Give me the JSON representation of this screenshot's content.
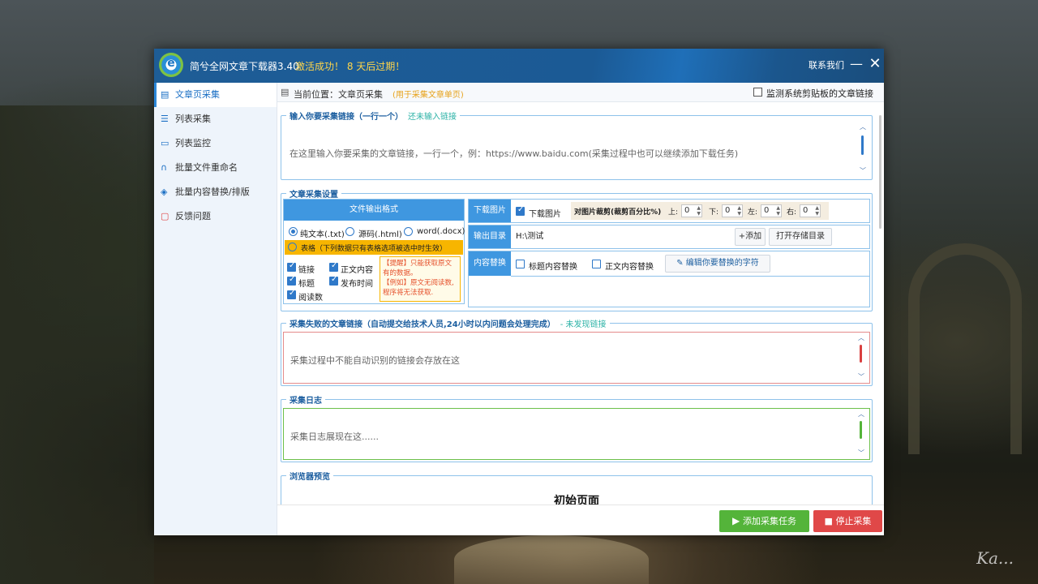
{
  "window": {
    "title": "简兮全网文章下载器3.40",
    "activation": "激活成功！ 8 天后过期！",
    "contact": "联系我们",
    "minimize": "—",
    "close": "✕"
  },
  "sidebar": {
    "items": [
      {
        "label": "文章页采集",
        "icon": "document-icon",
        "active": true
      },
      {
        "label": "列表采集",
        "icon": "list-search-icon",
        "active": false
      },
      {
        "label": "列表监控",
        "icon": "monitor-icon",
        "active": false
      },
      {
        "label": "批量文件重命名",
        "icon": "headset-icon",
        "active": false
      },
      {
        "label": "批量内容替换/排版",
        "icon": "layers-icon",
        "active": false
      },
      {
        "label": "反馈问题",
        "icon": "feedback-icon",
        "active": false
      }
    ]
  },
  "pathbar": {
    "location": "当前位置：文章页采集",
    "note": "(用于采集文章单页)",
    "monitor_label": "监测系统剪贴板的文章链接"
  },
  "input_links": {
    "legend": "输入你要采集链接（一行一个）",
    "status": "还未输入链接",
    "placeholder": "在这里输入你要采集的文章链接，一行一个，例：https://www.baidu.com(采集过程中也可以继续添加下载任务)"
  },
  "settings": {
    "legend": "文章采集设置",
    "format_header": "文件输出格式",
    "formats": [
      "纯文本(.txt)",
      "源码(.html)",
      "word(.docx)"
    ],
    "table_option": "表格（下列数据只有表格选项被选中时生效）",
    "fields": [
      "链接",
      "正文内容",
      "标题",
      "发布时间",
      "阅读数"
    ],
    "notice": "【提醒】只能获取原文有的数据。\n【例如】原文无阅读数,程序将无法获取.",
    "download_images": {
      "row_label": "下载图片",
      "checkbox_label": "下载图片",
      "crop_label": "对图片裁剪(裁剪百分比%)",
      "crop": [
        {
          "label": "上:",
          "value": "0"
        },
        {
          "label": "下:",
          "value": "0"
        },
        {
          "label": "左:",
          "value": "0"
        },
        {
          "label": "右:",
          "value": "0"
        }
      ]
    },
    "output": {
      "row_label": "输出目录",
      "path": "H:\\测试",
      "add_button": "+添加",
      "open_button": "打开存储目录"
    },
    "replace": {
      "row_label": "内容替换",
      "title_replace": "标题内容替换",
      "body_replace": "正文内容替换",
      "edit_button": "编辑你要替换的字符"
    }
  },
  "failed": {
    "legend": "采集失败的文章链接（自动提交给技术人员,24小时以内问题会处理完成）",
    "status": "- 未发现链接",
    "placeholder": "采集过程中不能自动识别的链接会存放在这"
  },
  "log": {
    "legend": "采集日志",
    "placeholder": "采集日志展现在这......"
  },
  "preview": {
    "legend": "浏览器预览",
    "heading": "初始页面"
  },
  "footer": {
    "add_task": "添加采集任务",
    "stop": "停止采集"
  },
  "wallpaper": {
    "signature": "Ka..."
  },
  "colors": {
    "accent": "#2a86d8",
    "titlebar": "#1b5a95",
    "green": "#54b43a",
    "red": "#e04848",
    "orange": "#f7b500"
  }
}
